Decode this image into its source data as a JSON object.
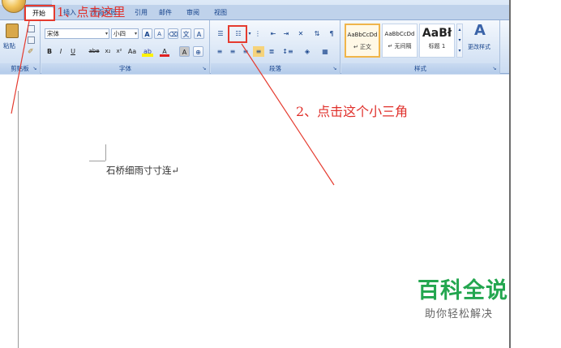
{
  "ribbon": {
    "tabs": [
      {
        "label": "开始"
      },
      {
        "label": "插入"
      },
      {
        "label": "页面布局"
      },
      {
        "label": "引用"
      },
      {
        "label": "邮件"
      },
      {
        "label": "审阅"
      },
      {
        "label": "视图"
      }
    ],
    "clipboard": {
      "paste_label": "粘贴",
      "group_label": "剪贴板"
    },
    "font": {
      "font_name": "宋体",
      "font_size": "小四",
      "grow_label": "A",
      "shrink_label": "A",
      "group_label": "字体",
      "buttons": [
        "B",
        "I",
        "U",
        "abe",
        "x₂",
        "x²",
        "A",
        "A"
      ]
    },
    "paragraph": {
      "group_label": "段落"
    },
    "styles": {
      "group_label": "样式",
      "items": [
        {
          "sample": "AaBbCcDd",
          "name": "↵ 正文"
        },
        {
          "sample": "AaBbCcDd",
          "name": "↵ 无间隔"
        },
        {
          "sample": "AaBł",
          "name": "标题 1"
        }
      ],
      "change_styles_label": "更改样式"
    }
  },
  "document": {
    "text": "石桥细雨寸寸连↵"
  },
  "annotations": {
    "step1": "1、点击这里",
    "step2": "2、点击这个小三角"
  },
  "watermark": {
    "brand": "百科全说",
    "tagline": "助你轻松解决"
  },
  "colors": {
    "annotation_red": "#e0302b",
    "brand_green": "#23a64f"
  }
}
